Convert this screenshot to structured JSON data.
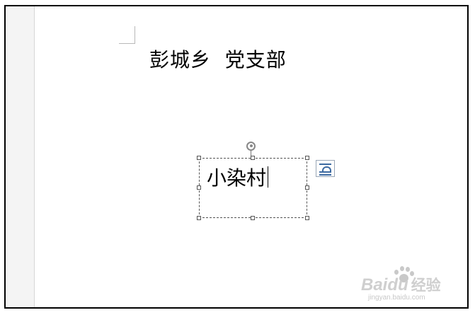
{
  "document": {
    "heading": "彭城乡  党支部",
    "textbox_text": "小染村"
  },
  "icons": {
    "rotation": "rotate-handle-icon",
    "layout_options": "layout-options-icon"
  },
  "watermark": {
    "brand": "Bai",
    "brand_du": "du",
    "brand_cn": "经验",
    "url": "jingyan.baidu.com"
  },
  "colors": {
    "page": "#ffffff",
    "left_strip": "#f4f4f4",
    "frame": "#000000",
    "selection_border": "#555555",
    "layout_icon": "#3d6aa1"
  }
}
